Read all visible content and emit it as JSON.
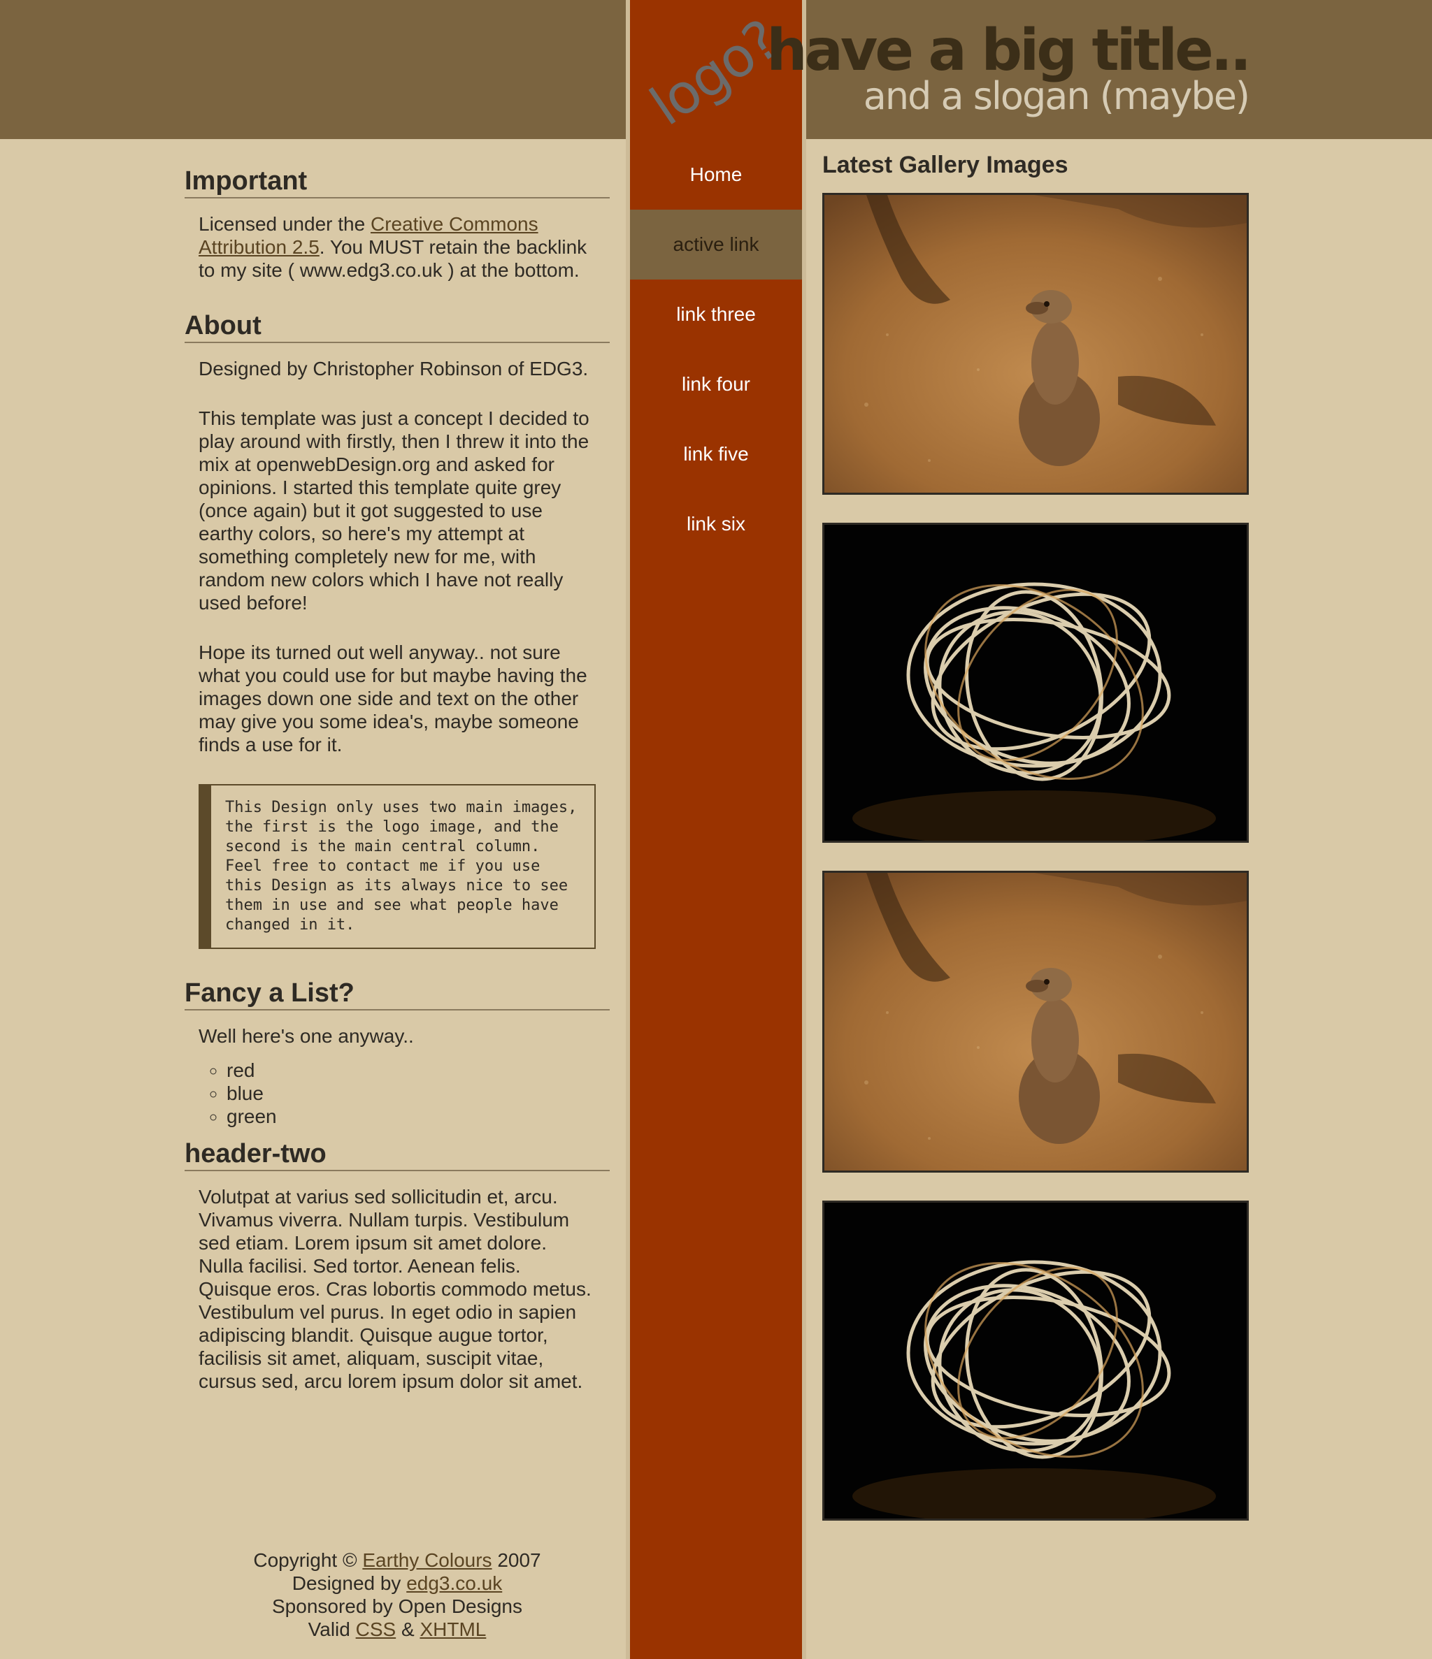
{
  "header": {
    "logo_text": "logo?",
    "title": "have a big title..",
    "slogan": "and a slogan (maybe)"
  },
  "nav": {
    "items": [
      {
        "label": "Home"
      },
      {
        "label": "active link"
      },
      {
        "label": "link three"
      },
      {
        "label": "link four"
      },
      {
        "label": "link five"
      },
      {
        "label": "link six"
      }
    ]
  },
  "sections": {
    "important": {
      "heading": "Important",
      "text_before": "Licensed under the ",
      "link": "Creative Commons Attribution 2.5",
      "text_after": ". You MUST retain the backlink to my site ( www.edg3.co.uk ) at the bottom."
    },
    "about": {
      "heading": "About",
      "paragraphs": [
        "Designed by Christopher Robinson of EDG3.",
        "This template was just a concept I decided to play around with firstly, then I threw it into the mix at openwebDesign.org and asked for opinions. I started this template quite grey (once again) but it got suggested to use earthy colors, so here's my attempt at something completely new for me, with random new colors which I have not really used before!",
        "Hope its turned out well anyway.. not sure what you could use for but maybe having the images down one side and text on the other may give you some idea's, maybe someone finds a use for it."
      ],
      "code": "This Design only uses two main images, the first is the logo image, and the second is the main central column. Feel free to contact me if you use this Design as its always nice to see them in use and see what people have changed in it."
    },
    "list": {
      "heading": "Fancy a List?",
      "intro": "Well here's one anyway..",
      "items": [
        "red",
        "blue",
        "green"
      ]
    },
    "header_two": {
      "heading": "header-two",
      "text": "Volutpat at varius sed sollicitudin et, arcu. Vivamus viverra. Nullam turpis. Vestibulum sed etiam. Lorem ipsum sit amet dolore. Nulla facilisi. Sed tortor. Aenean felis. Quisque eros. Cras lobortis commodo metus. Vestibulum vel purus. In eget odio in sapien adipiscing blandit. Quisque augue tortor, facilisis sit amet, aliquam, suscipit vitae, cursus sed, arcu lorem ipsum dolor sit amet."
    }
  },
  "gallery": {
    "heading": "Latest Gallery Images",
    "images": [
      "meerkat",
      "fire-spin",
      "meerkat",
      "fire-spin"
    ]
  },
  "footer": {
    "copyright_prefix": "Copyright © ",
    "copyright_link": "Earthy Colours",
    "copyright_suffix": " 2007",
    "designed_prefix": "Designed by ",
    "designed_link": "edg3.co.uk",
    "sponsored": "Sponsored by Open Designs",
    "valid_prefix": "Valid ",
    "css_link": "CSS",
    "amp": " & ",
    "xhtml_link": "XHTML"
  },
  "colors": {
    "page_bg": "#d9c9a7",
    "header_band": "#7b6440",
    "center_column": "#9a3300",
    "active_nav": "#7b6440",
    "text": "#2e2a24",
    "link": "#5a4422"
  }
}
